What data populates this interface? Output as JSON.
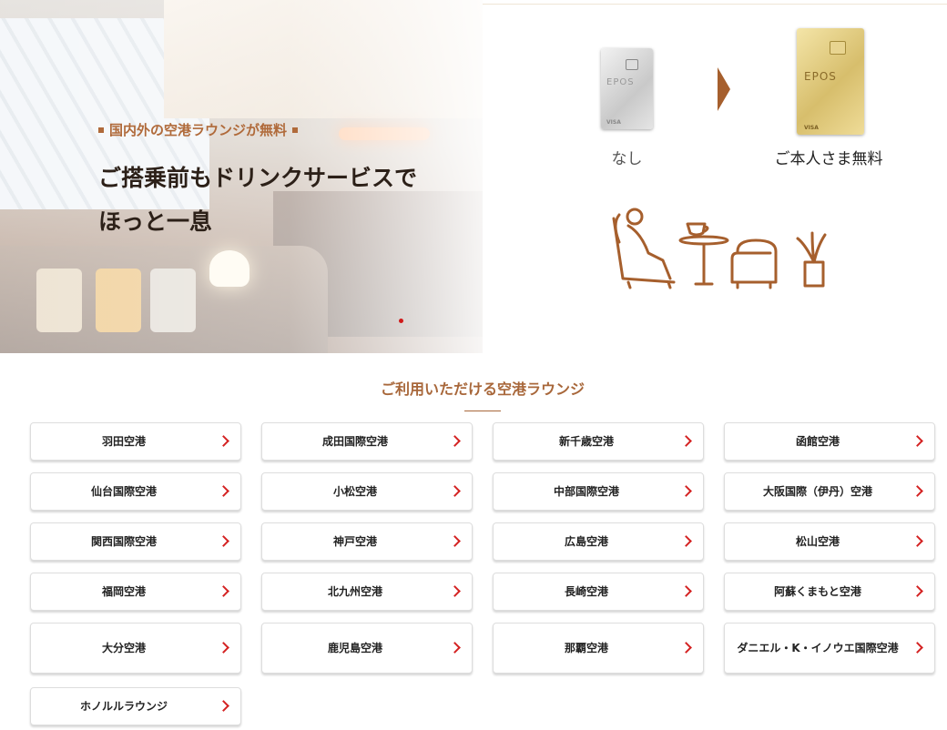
{
  "hero": {
    "tag": "国内外の空港ラウンジが無料",
    "title_line1": "ご搭乗前もドリンクサービスで",
    "title_line2": "ほっと一息"
  },
  "comparison": {
    "before_card_icon": "silver-card-icon",
    "after_card_icon": "gold-card-icon",
    "card_brand": "EPOS",
    "card_network": "VISA",
    "before_label": "なし",
    "after_label": "ご本人さま無料",
    "arrow_color": "#a65f2d",
    "illustration_icon": "lounge-illustration-icon"
  },
  "section": {
    "title": "ご利用いただける空港ラウンジ",
    "accent_color": "#a8673a"
  },
  "lounges": [
    "羽田空港",
    "成田国際空港",
    "新千歳空港",
    "函館空港",
    "仙台国際空港",
    "小松空港",
    "中部国際空港",
    "大阪国際（伊丹）空港",
    "関西国際空港",
    "神戸空港",
    "広島空港",
    "松山空港",
    "福岡空港",
    "北九州空港",
    "長崎空港",
    "阿蘇くまもと空港",
    "大分空港",
    "鹿児島空港",
    "那覇空港",
    "ダニエル・K・イノウエ国際空港",
    "ホノルルラウンジ"
  ],
  "chevron_icon": "chevron-right-icon",
  "chevron_color": "#d42222"
}
